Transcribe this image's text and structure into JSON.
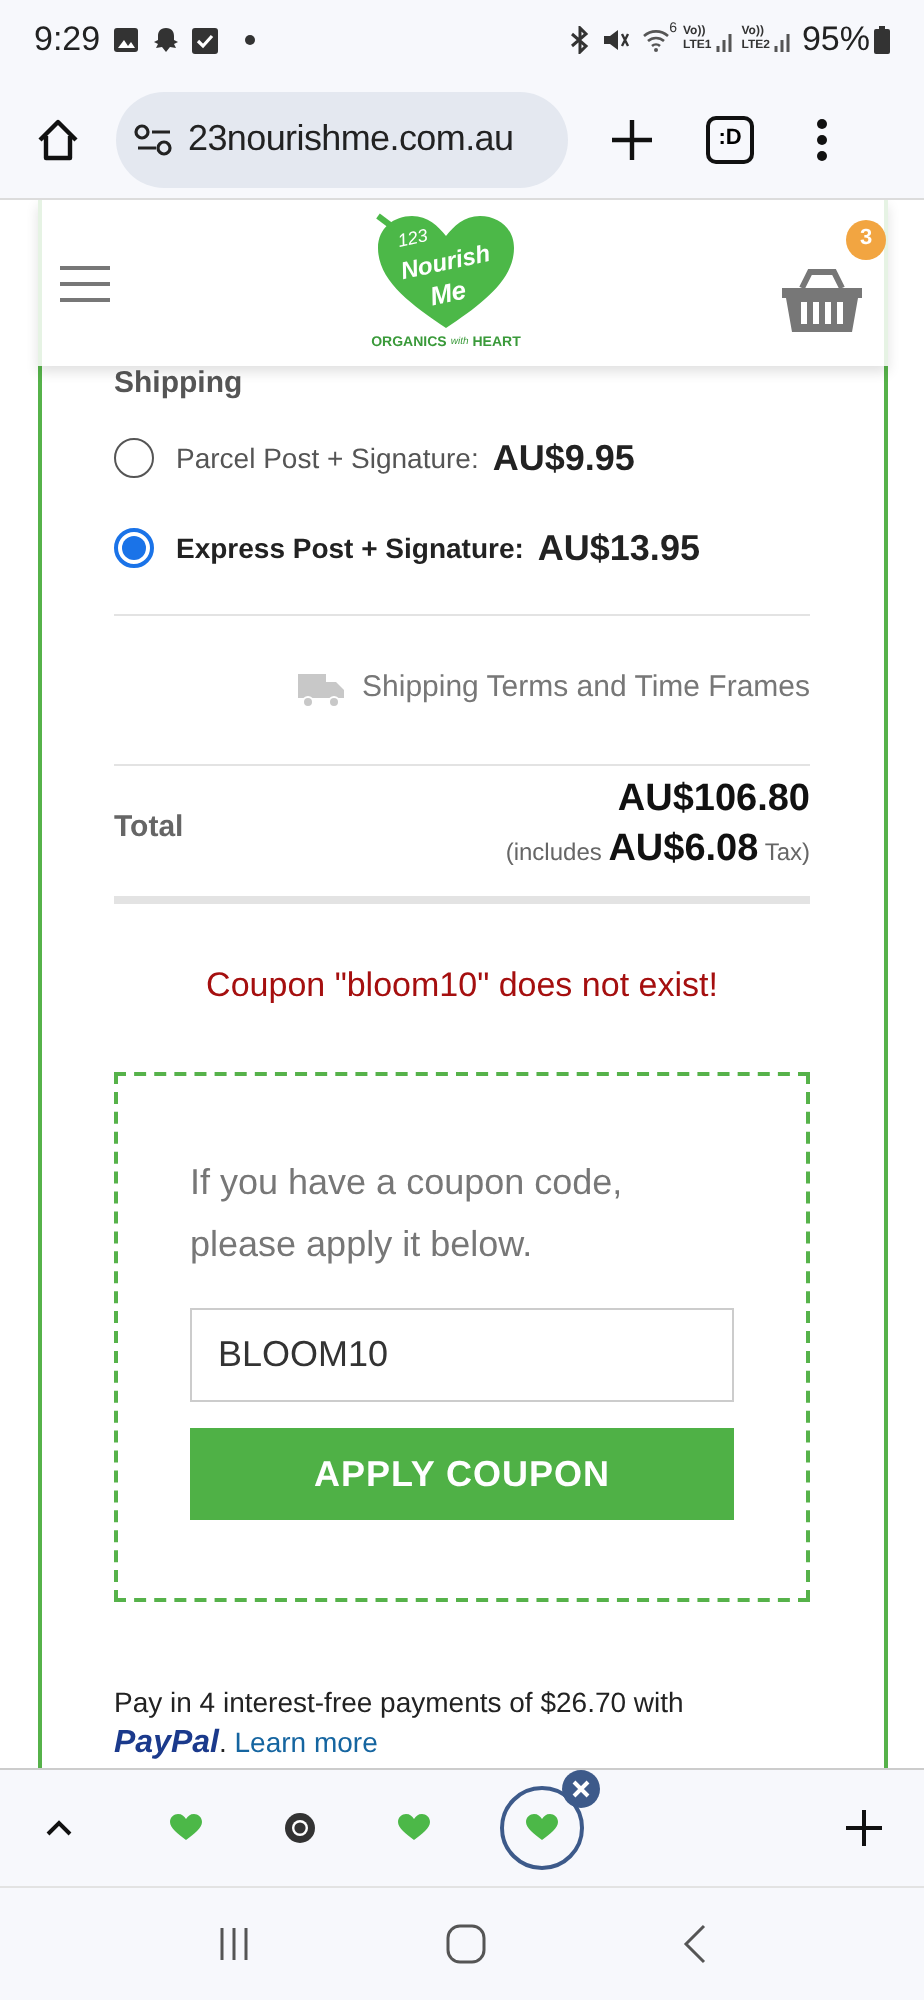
{
  "status_bar": {
    "time": "9:29",
    "wifi_band": "6",
    "sims": [
      {
        "top": "Vo))",
        "bottom": "LTE1"
      },
      {
        "top": "Vo))",
        "bottom": "LTE2"
      }
    ],
    "battery": "95%"
  },
  "browser": {
    "url": "23nourishme.com.au",
    "tab_switcher": ":D"
  },
  "header": {
    "logo": {
      "number": "123",
      "line1": "Nourish",
      "line2": "Me",
      "tagline_left": "ORGANICS",
      "tagline_mid": "with",
      "tagline_right": "HEART"
    },
    "cart_count": "3"
  },
  "shipping": {
    "label": "Shipping",
    "options": [
      {
        "label": "Parcel Post + Signature:",
        "price": "AU$9.95",
        "selected": false
      },
      {
        "label": "Express Post + Signature:",
        "price": "AU$13.95",
        "selected": true
      }
    ],
    "terms_link": "Shipping Terms and Time Frames"
  },
  "total": {
    "label": "Total",
    "value": "AU$106.80",
    "tax_prefix": "(includes",
    "tax_value": "AU$6.08",
    "tax_suffix": "Tax)"
  },
  "coupon": {
    "error": "Coupon \"bloom10\" does not exist!",
    "prompt": "If you have a coupon code, please apply it below.",
    "value": "BLOOM10",
    "button": "APPLY COUPON"
  },
  "paypal": {
    "text": "Pay in 4 interest-free payments of $26.70 with",
    "brand": "PayPal",
    "after": ".",
    "link": "Learn more"
  },
  "tab_strip": {
    "tabs": [
      {
        "kind": "site",
        "selected": false
      },
      {
        "kind": "chrome",
        "selected": false
      },
      {
        "kind": "site",
        "selected": false
      },
      {
        "kind": "site",
        "selected": true
      }
    ]
  }
}
